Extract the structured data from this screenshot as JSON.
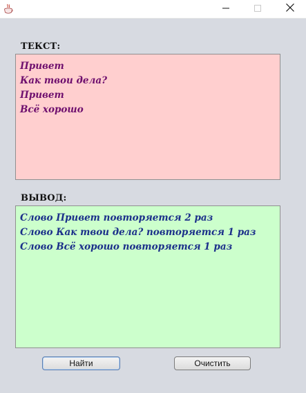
{
  "window": {
    "icon": "coffee-cup-icon",
    "controls": [
      "minimize-icon",
      "maximize-icon",
      "close-icon"
    ]
  },
  "input": {
    "label": "ТЕКСТ:",
    "lines": [
      "Привет",
      "Как твои дела?",
      "Привет",
      "Всё хорошо"
    ],
    "background": "#ffcfcf",
    "text_color": "#6e0f6e"
  },
  "output": {
    "label": "ВЫВОД:",
    "lines": [
      "Слово Привет повторяется 2 раз",
      "Слово Как твои дела? повторяется 1 раз",
      "Слово Всё хорошо повторяется 1 раз"
    ],
    "background": "#ccffcc",
    "text_color": "#1b2f8a"
  },
  "buttons": {
    "find_label": "Найти",
    "clear_label": "Очистить"
  }
}
